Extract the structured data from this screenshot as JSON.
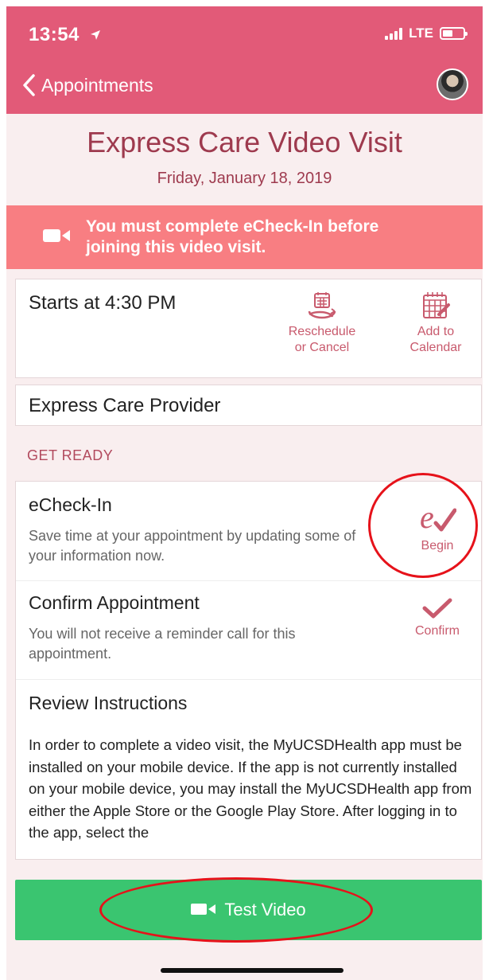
{
  "status_bar": {
    "time": "13:54",
    "network": "LTE"
  },
  "nav": {
    "back_label": "Appointments"
  },
  "visit": {
    "title": "Express Care Video Visit",
    "date": "Friday, January 18, 2019"
  },
  "banner": {
    "text_line1": "You must complete eCheck-In before",
    "text_line2": "joining this video visit."
  },
  "schedule": {
    "starts": "Starts at 4:30 PM",
    "reschedule_line1": "Reschedule",
    "reschedule_line2": "or Cancel",
    "calendar_line1": "Add to",
    "calendar_line2": "Calendar"
  },
  "provider": {
    "name": "Express Care Provider"
  },
  "get_ready": {
    "label": "GET READY",
    "echeckin": {
      "title": "eCheck-In",
      "desc": "Save time at your appointment by updating some of your information now.",
      "action": "Begin"
    },
    "confirm": {
      "title": "Confirm Appointment",
      "desc": "You will not receive a reminder call for this appointment.",
      "action": "Confirm"
    },
    "review": {
      "title": "Review Instructions",
      "body": "In order to complete a video visit, the MyUCSDHealth app must be installed on your mobile device. If the app is not currently installed on your mobile device, you may install the MyUCSDHealth app from either the Apple Store or the Google Play Store. After logging in to the app, select the"
    }
  },
  "test_video": {
    "label": "Test Video"
  },
  "colors": {
    "header": "#e25a78",
    "banner": "#f87e82",
    "accent": "#c85a6d",
    "button": "#3ac570",
    "annotation": "#e6121a"
  },
  "icons": [
    "location-arrow-icon",
    "signal-icon",
    "battery-icon",
    "chevron-left-icon",
    "video-camera-icon",
    "reschedule-icon",
    "calendar-add-icon",
    "echeck-icon",
    "checkmark-icon"
  ]
}
